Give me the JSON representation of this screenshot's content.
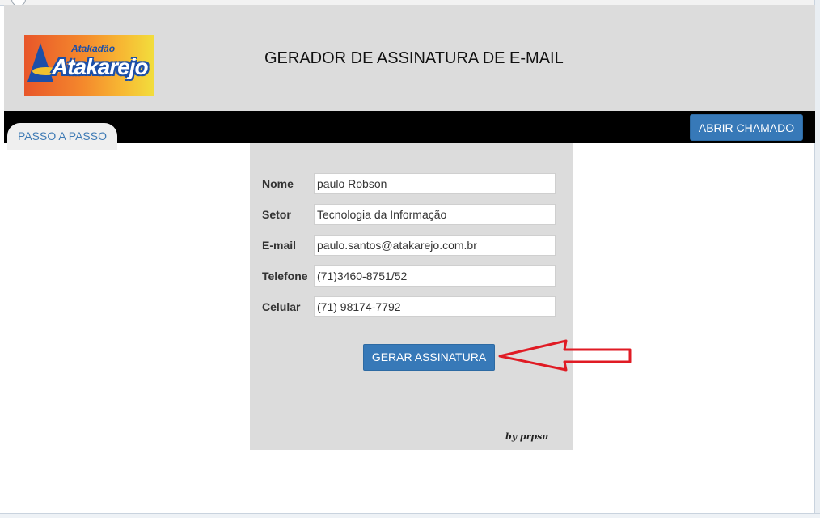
{
  "header": {
    "logo": {
      "top_text": "Atakadão",
      "brand_text": "Atakarejo"
    },
    "title": "GERADOR DE ASSINATURA DE E-MAIL"
  },
  "nav": {
    "tab_label": "PASSO A PASSO",
    "ticket_button_label": "ABRIR CHAMADO"
  },
  "form": {
    "fields": [
      {
        "label": "Nome",
        "value": "paulo Robson"
      },
      {
        "label": "Setor",
        "value": "Tecnologia da Informação"
      },
      {
        "label": "E-mail",
        "value": "paulo.santos@atakarejo.com.br"
      },
      {
        "label": "Telefone",
        "value": "(71)3460-8751/52"
      },
      {
        "label": "Celular",
        "value": "(71) 98174-7792"
      }
    ],
    "submit_label": "GERAR ASSINATURA",
    "credit": "by prpsu"
  },
  "colors": {
    "header_bg": "#dcdcdc",
    "nav_bg": "#000000",
    "button_blue": "#3779b8",
    "annotation_arrow": "#e01b24"
  }
}
